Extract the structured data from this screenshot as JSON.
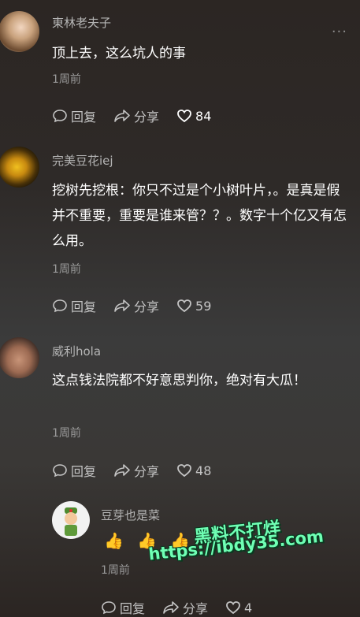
{
  "comments": [
    {
      "username": "東林老夫子",
      "text": "顶上去，这么坑人的事",
      "time": "1周前",
      "reply_label": "回复",
      "share_label": "分享",
      "likes": "84"
    },
    {
      "username": "完美豆花iej",
      "text": "挖树先挖根：你只不过是个小树叶片，。是真是假并不重要，重要是谁来管？？。数字十个亿又有怎么用。",
      "time": "1周前",
      "reply_label": "回复",
      "share_label": "分享",
      "likes": "59"
    },
    {
      "username": "威利hola",
      "text": "这点钱法院都不好意思判你，绝对有大瓜！",
      "time": "1周前",
      "reply_label": "回复",
      "share_label": "分享",
      "likes": "48"
    }
  ],
  "reply": {
    "username": "豆芽也是菜",
    "emojis": [
      "👍",
      "👍",
      "👍"
    ],
    "time": "1周前",
    "reply_label": "回复",
    "share_label": "分享",
    "likes": "4"
  },
  "more_label": "···",
  "watermark": {
    "line1": "黑料不打烊",
    "line2": "https://ibdy35.com"
  },
  "colors": {
    "username": "#b5b5b5",
    "watermark": "#6fffb4"
  }
}
